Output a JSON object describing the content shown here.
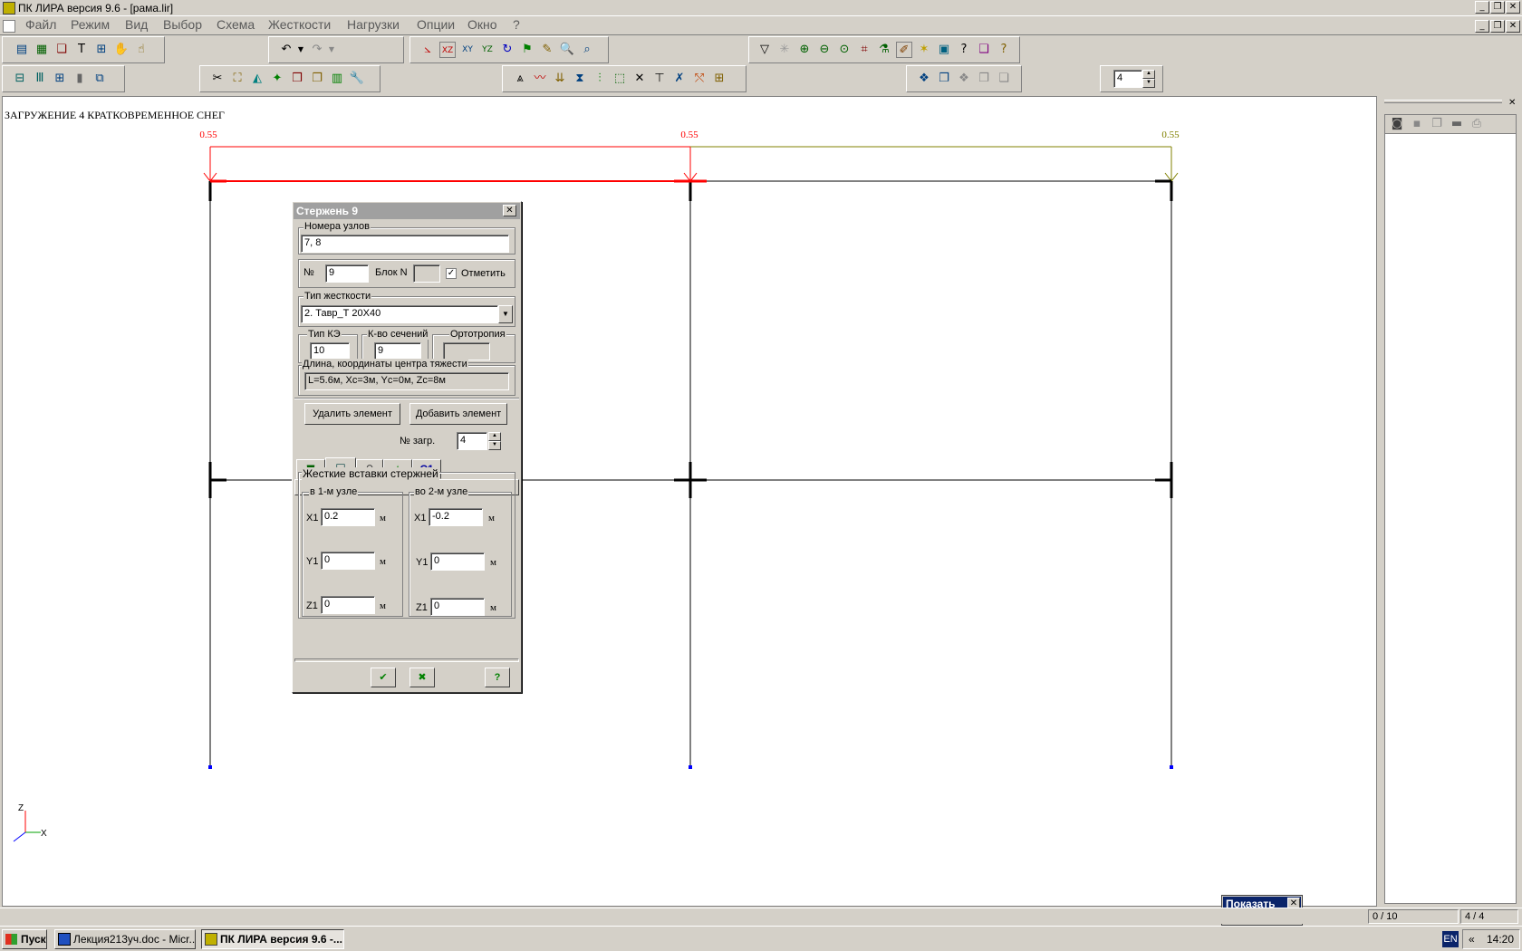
{
  "window": {
    "title": "ПК ЛИРА  версия 9.6 - [рама.lir]"
  },
  "menu": [
    "Файл",
    "Режим",
    "Вид",
    "Выбор",
    "Схема",
    "Жесткости",
    "Нагрузки",
    "Опции",
    "Окно",
    "?"
  ],
  "toolbar": {
    "spin_value": "4"
  },
  "canvas": {
    "heading": "ЗАГРУЖЕНИЕ 4 КРАТКОВРЕМЕННОЕ СНЕГ",
    "load_labels": [
      "0.55",
      "0.55",
      "0.55"
    ],
    "axis_z": "Z",
    "axis_x": "X",
    "colors": {
      "load_red": "#ff0000",
      "load_olive": "#808000",
      "frame": "#000000",
      "support": "#0000ff"
    }
  },
  "dialog": {
    "title": "Стержень  9",
    "nodes_group": "Номера узлов",
    "nodes_value": "7, 8",
    "num_label": "№",
    "num_value": "9",
    "block_label": "Блок N",
    "block_value": "",
    "mark_label": "Отметить",
    "mark_checked": "✓",
    "stiff_group": "Тип жесткости",
    "stiff_value": "2. Тавр_Т 20Х40",
    "ke_group": "Тип КЭ",
    "ke_value": "10",
    "sections_group": "К-во сечений",
    "sections_value": "9",
    "ortho_group": "Ортотропия",
    "ortho_value": "",
    "length_group": "Длина, координаты центра тяжести",
    "length_value": "L=5.6м, Xc=3м, Yc=0м, Zc=8м",
    "delete_btn": "Удалить элемент",
    "add_btn": "Добавить элемент",
    "load_num_label": "№ загр.",
    "load_num_value": "4",
    "tab_c1": "С1",
    "inserts_group": "Жесткие вставки стержней",
    "node1_group": "в 1-м узле",
    "node2_group": "во 2-м узле",
    "x1_label": "X1",
    "y1_label": "Y1",
    "z1_label": "Z1",
    "unit": "м",
    "n1": {
      "x1": "0.2",
      "y1": "0",
      "z1": "0"
    },
    "n2": {
      "x1": "-0.2",
      "y1": "0",
      "z1": "0"
    }
  },
  "show_panel": {
    "title": "Показать"
  },
  "status": {
    "count1": "0 / 10",
    "count2": "4 / 4"
  },
  "taskbar": {
    "start": "Пуск",
    "tasks": [
      "Лекция213уч.doc - Micr...",
      "ПК ЛИРА  версия 9.6 -..."
    ],
    "lang": "EN",
    "clock": "14:20",
    "chevron": "«"
  }
}
